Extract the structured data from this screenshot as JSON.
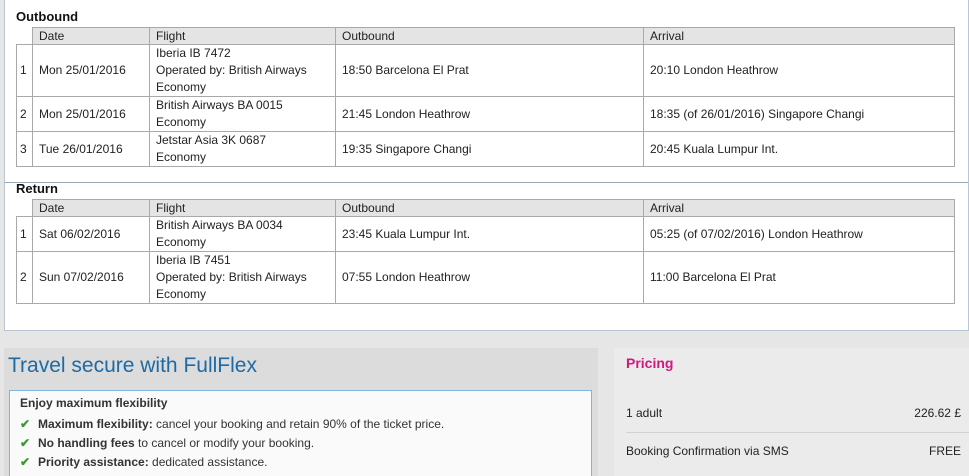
{
  "outbound": {
    "title": "Outbound",
    "headers": [
      "Date",
      "Flight",
      "Outbound",
      "Arrival"
    ],
    "rows": [
      {
        "num": "1",
        "date": "Mon 25/01/2016",
        "flight": [
          "Iberia IB 7472",
          "Operated by: British Airways",
          "Economy"
        ],
        "outbound": "18:50 Barcelona El Prat",
        "arrival": "20:10 London Heathrow"
      },
      {
        "num": "2",
        "date": "Mon 25/01/2016",
        "flight": [
          "British Airways BA 0015",
          "Economy"
        ],
        "outbound": "21:45 London Heathrow",
        "arrival": "18:35 (of 26/01/2016) Singapore Changi"
      },
      {
        "num": "3",
        "date": "Tue 26/01/2016",
        "flight": [
          "Jetstar Asia 3K 0687",
          "Economy"
        ],
        "outbound": "19:35 Singapore Changi",
        "arrival": "20:45 Kuala Lumpur Int."
      }
    ]
  },
  "return": {
    "title": "Return",
    "headers": [
      "Date",
      "Flight",
      "Outbound",
      "Arrival"
    ],
    "rows": [
      {
        "num": "1",
        "date": "Sat 06/02/2016",
        "flight": [
          "British Airways BA 0034",
          "Economy"
        ],
        "outbound": "23:45 Kuala Lumpur Int.",
        "arrival": "05:25 (of 07/02/2016) London Heathrow"
      },
      {
        "num": "2",
        "date": "Sun 07/02/2016",
        "flight": [
          "Iberia IB 7451",
          "Operated by: British Airways",
          "Economy"
        ],
        "outbound": "07:55 London Heathrow",
        "arrival": "11:00 Barcelona El Prat"
      }
    ]
  },
  "fullflex": {
    "title": "Travel secure with FullFlex",
    "heading": "Enjoy maximum flexibility",
    "items": [
      {
        "bold": "Maximum flexibility:",
        "text": " cancel your booking and retain 90% of the ticket price."
      },
      {
        "bold": "No handling fees",
        "text": " to cancel or modify your booking."
      },
      {
        "bold": "Priority assistance:",
        "text": " dedicated assistance."
      }
    ]
  },
  "pricing": {
    "title": "Pricing",
    "rows": [
      {
        "label": "1 adult",
        "value": "226.62 £"
      },
      {
        "label": "Booking Confirmation via SMS",
        "value": "FREE"
      }
    ]
  },
  "colors": {
    "accent_blue": "#1d6aa5",
    "pricing_pink": "#d1187f",
    "check_green": "#3a9a2d"
  }
}
